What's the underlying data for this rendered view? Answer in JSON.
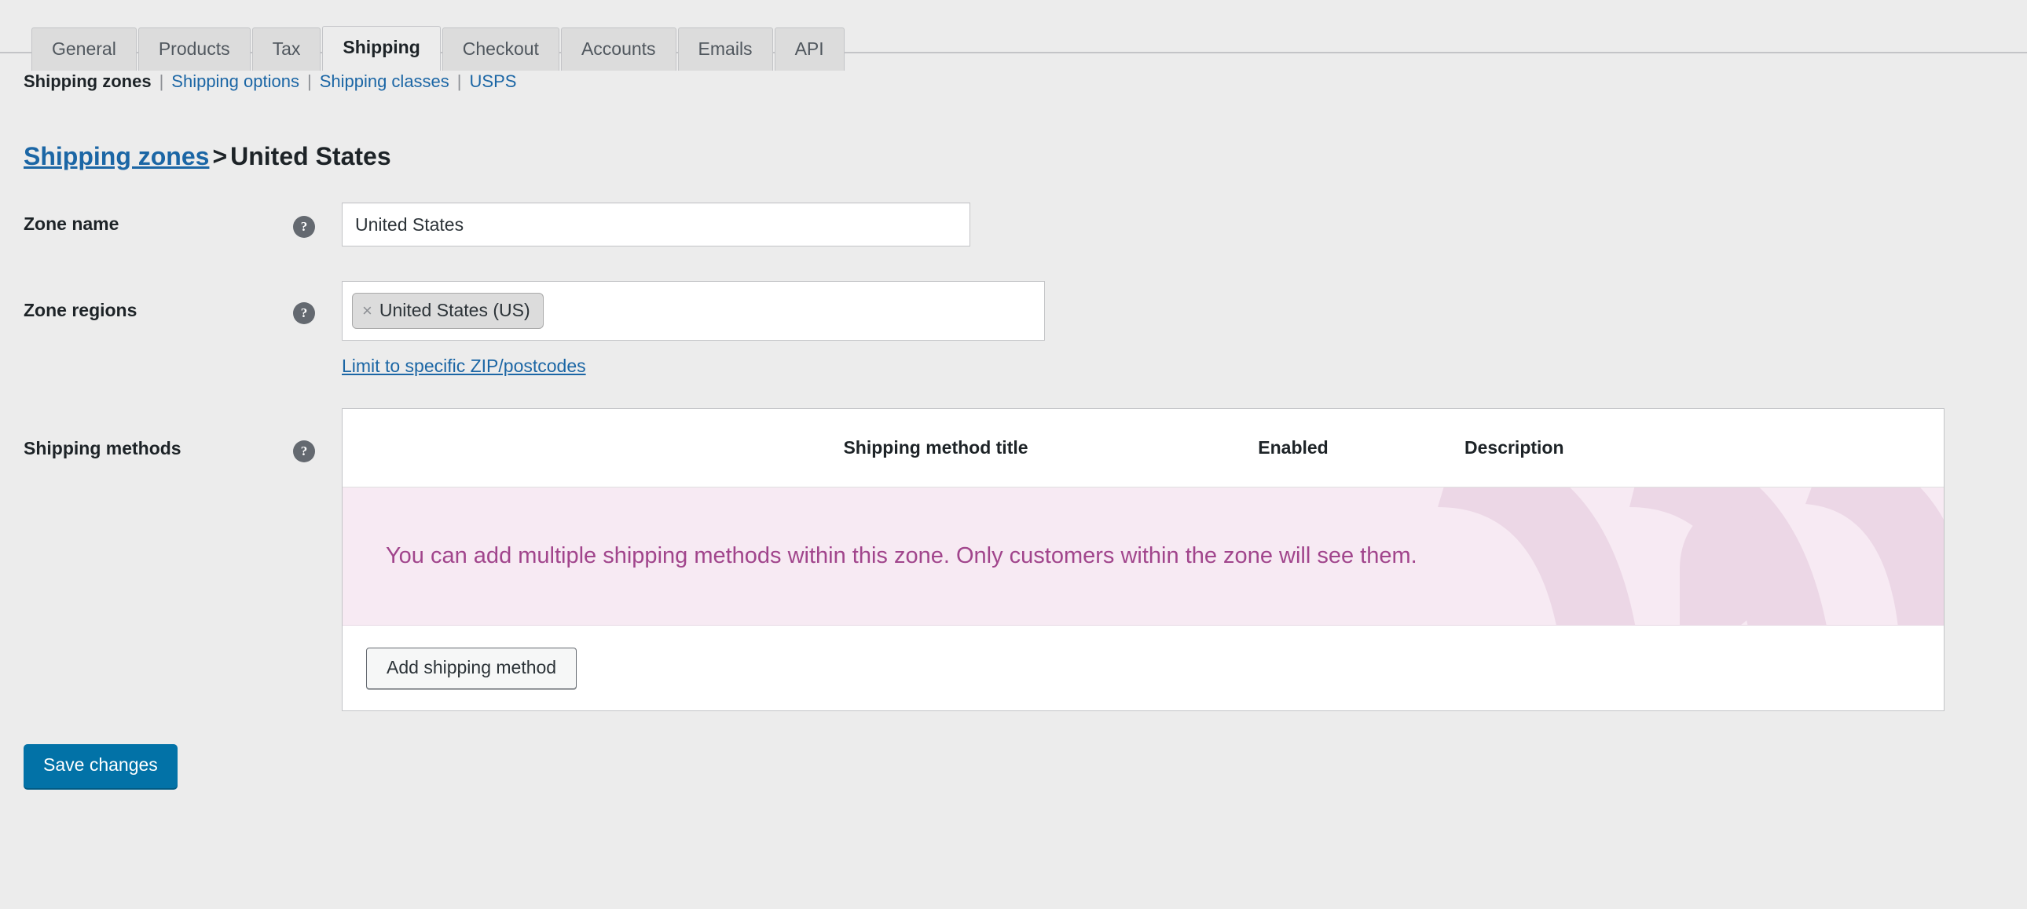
{
  "tabs": [
    {
      "label": "General",
      "active": false
    },
    {
      "label": "Products",
      "active": false
    },
    {
      "label": "Tax",
      "active": false
    },
    {
      "label": "Shipping",
      "active": true
    },
    {
      "label": "Checkout",
      "active": false
    },
    {
      "label": "Accounts",
      "active": false
    },
    {
      "label": "Emails",
      "active": false
    },
    {
      "label": "API",
      "active": false
    }
  ],
  "subnav": {
    "items": [
      {
        "label": "Shipping zones",
        "current": true
      },
      {
        "label": "Shipping options",
        "current": false
      },
      {
        "label": "Shipping classes",
        "current": false
      },
      {
        "label": "USPS",
        "current": false
      }
    ],
    "separator": "|"
  },
  "heading": {
    "link": "Shipping zones",
    "separator": ">",
    "current": "United States"
  },
  "form": {
    "zone_name": {
      "label": "Zone name",
      "help": "?",
      "value": "United States",
      "placeholder": "Zone name"
    },
    "zone_regions": {
      "label": "Zone regions",
      "help": "?",
      "chips": [
        {
          "remove": "×",
          "label": "United States (US)"
        }
      ],
      "limit_link": "Limit to specific ZIP/postcodes"
    },
    "shipping_methods": {
      "label": "Shipping methods",
      "help": "?",
      "columns": {
        "handle": "",
        "title": "Shipping method title",
        "enabled": "Enabled",
        "description": "Description"
      },
      "empty_message": "You can add multiple shipping methods within this zone. Only customers within the zone will see them.",
      "add_button": "Add shipping method"
    }
  },
  "actions": {
    "save": "Save changes"
  },
  "colors": {
    "page_background": "#ececec",
    "link_blue": "#1b66a5",
    "primary_button": "#0272a7",
    "message_background": "#f7eaf3",
    "message_text": "#a1458c",
    "watermark": "#ecd7e6",
    "border": "#c3c4c7"
  }
}
